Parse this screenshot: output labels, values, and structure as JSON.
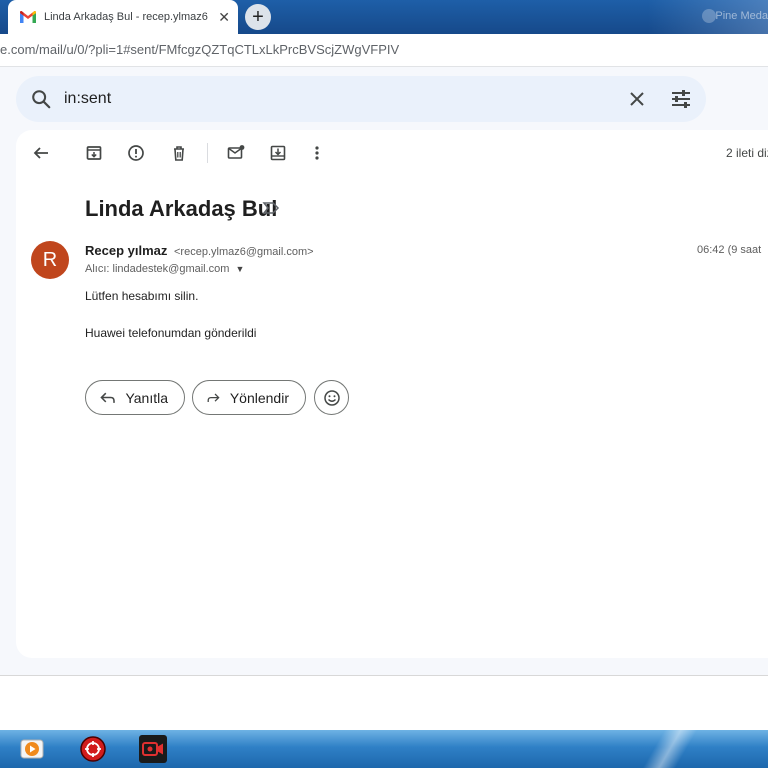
{
  "browser": {
    "tab_title": "Linda Arkadaş Bul - recep.ylmaz6",
    "tab_close": "✕",
    "new_tab": "+",
    "topright_text": "Pine Meda",
    "url": "e.com/mail/u/0/?pli=1#sent/FMfcgzQZTqCTLxLkPrcBVScjZWgVFPIV"
  },
  "search": {
    "query": "in:sent",
    "icons": [
      "search-icon",
      "clear-icon",
      "search-options-icon"
    ]
  },
  "toolbar": {
    "icons": [
      "back-icon",
      "archive-icon",
      "report-spam-icon",
      "delete-icon",
      "mark-unread-icon",
      "move-to-icon",
      "more-icon"
    ],
    "count": "2 ileti diz"
  },
  "message": {
    "subject": "Linda Arkadaş Bul",
    "avatar_letter": "R",
    "avatar_color": "#c0461d",
    "sender_name": "Recep yılmaz",
    "sender_email": "<recep.ylmaz6@gmail.com>",
    "recipient": "Alıcı: lindadestek@gmail.com",
    "time": "06:42 (9 saat",
    "body_line1": "Lütfen hesabımı silin.",
    "body_line2": "Huawei telefonumdan gönderildi"
  },
  "actions": {
    "reply_label": "Yanıtla",
    "forward_label": "Yönlendir"
  },
  "taskbar": {
    "apps": [
      "media-player-icon",
      "app-red-icon",
      "screen-recorder-icon"
    ]
  }
}
